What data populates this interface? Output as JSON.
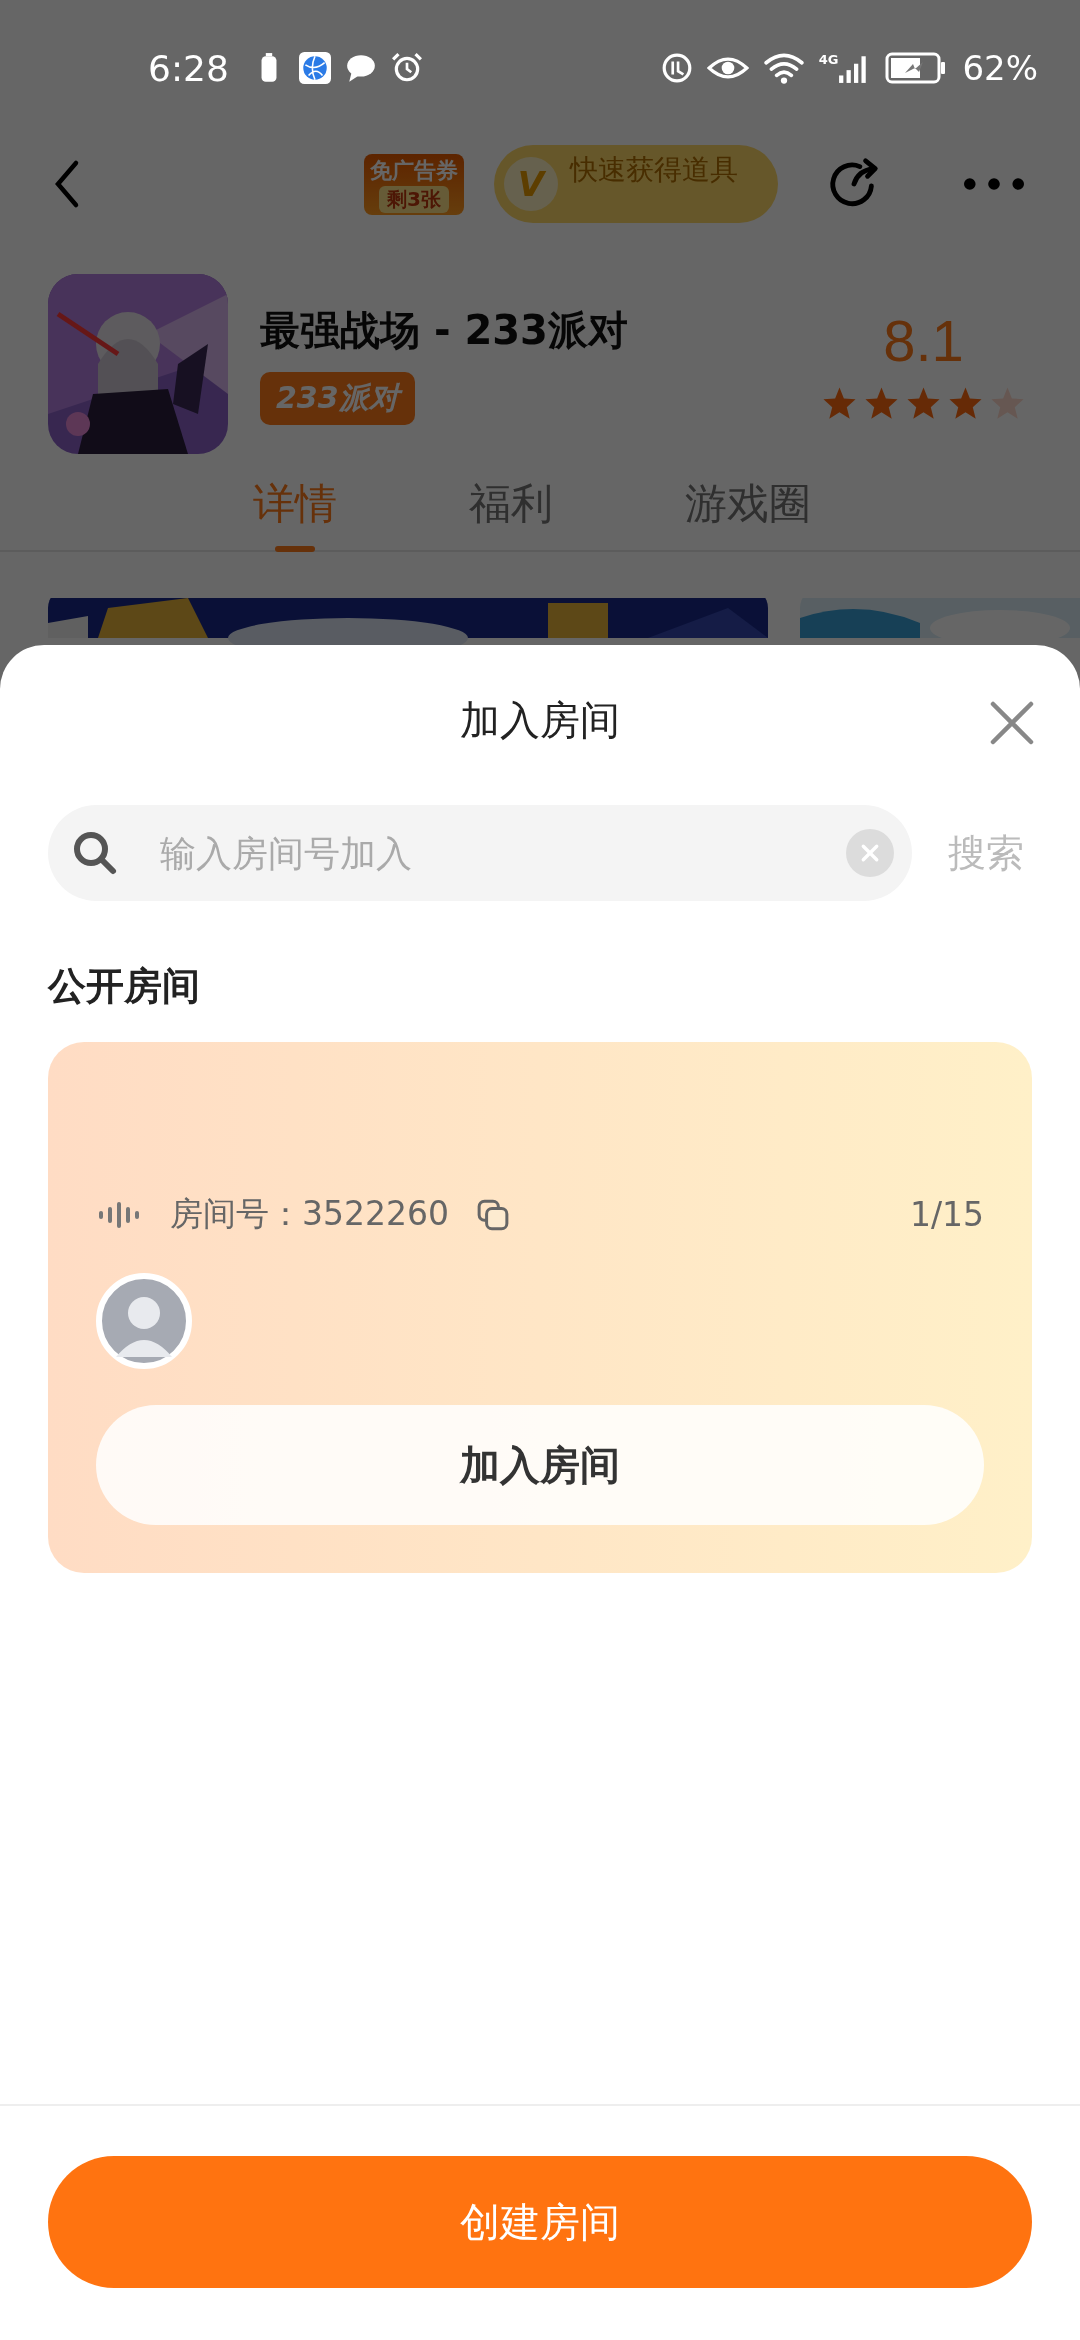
{
  "status_bar": {
    "time": "6:28",
    "network": "4G",
    "battery": "62%"
  },
  "header": {
    "coupon": {
      "line1": "免广告券",
      "line2": "剩3张"
    },
    "promo": {
      "badge": "V",
      "label": "快速获得道具"
    }
  },
  "game": {
    "title": "最强战场 - 233派对",
    "tag": "233派对",
    "rating": "8.1",
    "stars": 4
  },
  "tabs": [
    {
      "label": "详情",
      "selected": true
    },
    {
      "label": "福利",
      "selected": false
    },
    {
      "label": "游戏圈",
      "selected": false
    }
  ],
  "sheet": {
    "title": "加入房间",
    "search": {
      "placeholder": "输入房间号加入",
      "button": "搜索"
    },
    "section_title": "公开房间",
    "rooms": [
      {
        "room_label": "房间号：3522260",
        "occupancy": "1/15",
        "join_button": "加入房间"
      }
    ],
    "create_button": "创建房间"
  }
}
